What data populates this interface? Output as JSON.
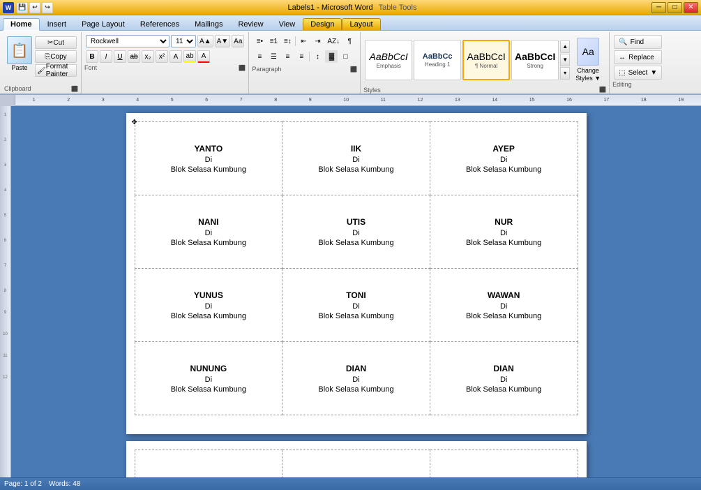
{
  "titleBar": {
    "title": "Labels1 - Microsoft Word",
    "tableTools": "Table Tools",
    "minBtn": "─",
    "maxBtn": "□",
    "closeBtn": "✕"
  },
  "ribbonTabs": [
    {
      "id": "home",
      "label": "Home",
      "active": true
    },
    {
      "id": "insert",
      "label": "Insert"
    },
    {
      "id": "pageLayout",
      "label": "Page Layout"
    },
    {
      "id": "references",
      "label": "References"
    },
    {
      "id": "mailings",
      "label": "Mailings"
    },
    {
      "id": "review",
      "label": "Review"
    },
    {
      "id": "view",
      "label": "View"
    },
    {
      "id": "design",
      "label": "Design"
    },
    {
      "id": "layout",
      "label": "Layout"
    }
  ],
  "ribbon": {
    "clipboard": {
      "label": "Clipboard",
      "paste": "Paste",
      "cut": "Cut",
      "copy": "Copy",
      "formatPainter": "Format Painter"
    },
    "font": {
      "label": "Font",
      "fontName": "Rockwell",
      "fontSize": "11",
      "bold": "B",
      "italic": "I",
      "underline": "U",
      "strikethrough": "ab",
      "subscript": "x₂",
      "superscript": "x²",
      "changeCase": "Aa",
      "highlight": "ab",
      "color": "A"
    },
    "paragraph": {
      "label": "Paragraph"
    },
    "styles": {
      "label": "Styles",
      "emphasis": "Emphasis",
      "heading1": "Heading 1",
      "normal": "¶ Normal",
      "strong": "Strong",
      "changeStyles": "Change Styles",
      "changeStylesLine2": "-"
    },
    "editing": {
      "label": "Editing",
      "find": "Find",
      "replace": "Replace",
      "select": "Select"
    }
  },
  "labels": [
    [
      {
        "name": "YANTO",
        "di": "Di",
        "location": "Blok Selasa Kumbung"
      },
      {
        "name": "IIK",
        "di": "Di",
        "location": "Blok Selasa Kumbung"
      },
      {
        "name": "AYEP",
        "di": "Di",
        "location": "Blok Selasa Kumbung"
      }
    ],
    [
      {
        "name": "NANI",
        "di": "Di",
        "location": "Blok Selasa Kumbung"
      },
      {
        "name": "UTIS",
        "di": "Di",
        "location": "Blok Selasa Kumbung"
      },
      {
        "name": "NUR",
        "di": "Di",
        "location": "Blok Selasa Kumbung"
      }
    ],
    [
      {
        "name": "YUNUS",
        "di": "Di",
        "location": "Blok Selasa Kumbung"
      },
      {
        "name": "TONI",
        "di": "Di",
        "location": "Blok Selasa Kumbung"
      },
      {
        "name": "WAWAN",
        "di": "Di",
        "location": "Blok Selasa Kumbung"
      }
    ],
    [
      {
        "name": "NUNUNG",
        "di": "Di",
        "location": "Blok Selasa Kumbung"
      },
      {
        "name": "DIAN",
        "di": "Di",
        "location": "Blok Selasa Kumbung"
      },
      {
        "name": "DIAN",
        "di": "Di",
        "location": "Blok Selasa Kumbung"
      }
    ]
  ],
  "styleBoxes": [
    {
      "sample": "AaBbCcI",
      "label": "Emphasis",
      "style": "italic"
    },
    {
      "sample": "AaBbCc",
      "label": "Heading 1",
      "style": "heading"
    },
    {
      "sample": "AaBbCcI",
      "label": "¶ Normal",
      "style": "normal",
      "selected": true
    },
    {
      "sample": "AaBbCcI",
      "label": "Strong",
      "style": "bold"
    }
  ]
}
